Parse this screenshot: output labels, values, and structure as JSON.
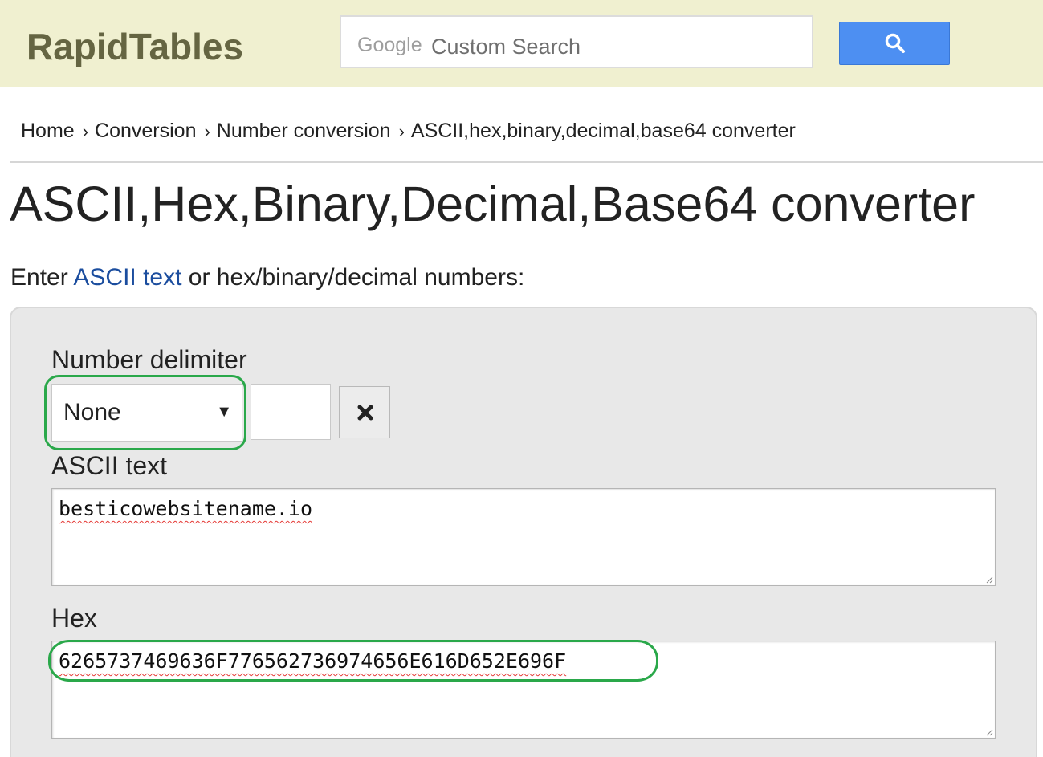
{
  "header": {
    "logo": "RapidTables",
    "search": {
      "brand": "Google",
      "placeholder": "Custom Search"
    },
    "search_button_icon": "search-icon",
    "colors": {
      "header_bg": "#f0f0d0",
      "logo": "#656542",
      "search_button": "#4d8ff2"
    }
  },
  "breadcrumb": {
    "items": [
      "Home",
      "Conversion",
      "Number conversion",
      "ASCII,hex,binary,decimal,base64 converter"
    ],
    "separator": "›"
  },
  "page_title": "ASCII,Hex,Binary,Decimal,Base64 converter",
  "intro": {
    "prefix": "Enter ",
    "link": "ASCII text",
    "suffix": " or hex/binary/decimal numbers:"
  },
  "converter": {
    "delimiter_label": "Number delimiter",
    "delimiter_selected": "None",
    "delimiter_custom_value": "",
    "clear_icon": "close-icon",
    "ascii_label": "ASCII text",
    "ascii_value": "besticowebsitename.io",
    "hex_label": "Hex",
    "hex_value": "6265737469636F776562736974656E616D652E696F",
    "highlight_color": "#2aa84a"
  }
}
